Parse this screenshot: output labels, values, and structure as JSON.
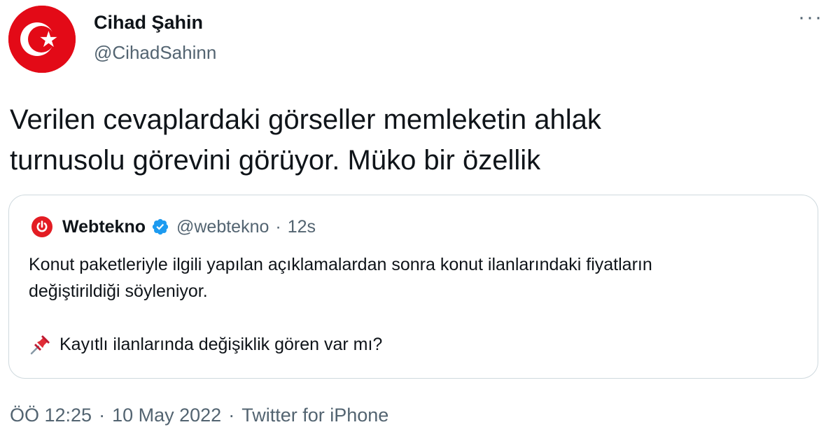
{
  "author": {
    "name": "Cihad Şahin",
    "handle": "@CihadSahinn",
    "avatar_icon": "turkish-flag-icon"
  },
  "more_icon": "more-icon",
  "more_label": "···",
  "tweet": {
    "lines": [
      "Verilen cevaplardaki görseller memleketin ahlak",
      "turnusolu görevini görüyor. Müko bir özellik"
    ]
  },
  "quoted": {
    "logo_icon": "power-logo-icon",
    "name": "Webtekno",
    "verified_icon": "verified-badge-icon",
    "handle": "@webtekno",
    "dot": "·",
    "time": "12s",
    "lines": [
      "Konut paketleriyle ilgili yapılan açıklamalardan sonra konut ilanlarındaki fiyatların",
      "değiştirildiği söyleniyor."
    ],
    "pin_icon": "pushpin-icon",
    "question": "Kayıtlı ilanlarında değişiklik gören var mı?"
  },
  "meta": {
    "time": "ÖÖ 12:25",
    "date": "10 May 2022",
    "source": "Twitter for iPhone",
    "separator": "·"
  },
  "colors": {
    "text": "#0f1419",
    "secondary": "#536471",
    "border": "#cfd9de",
    "flag_red": "#e30a17",
    "verified_blue": "#1d9bf0",
    "logo_red": "#e31c23"
  }
}
